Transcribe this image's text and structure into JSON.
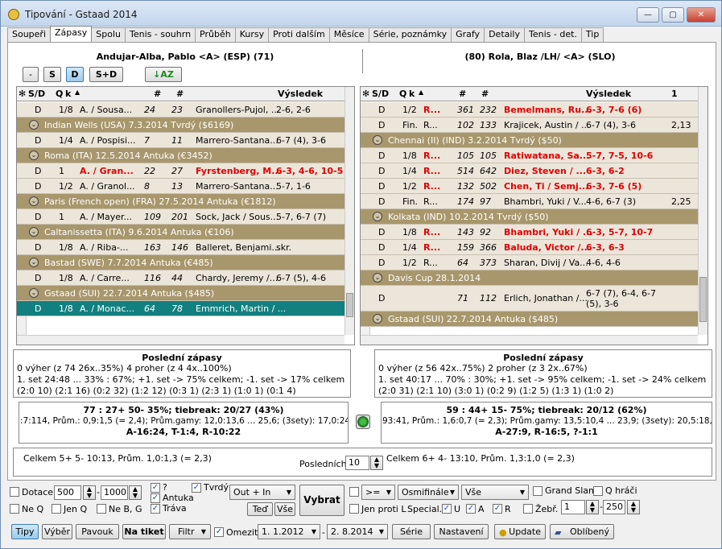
{
  "window": {
    "title": "Tipování - Gstaad 2014",
    "min": "—",
    "max": "▢",
    "close": "✕"
  },
  "tabs": [
    "Soupeři",
    "Zápasy",
    "Spolu",
    "Tenis - souhrn",
    "Průběh",
    "Kursy",
    "Proti dalším",
    "Měsíce",
    "Série, poznámky",
    "Grafy",
    "Detaily",
    "Tenis - det.",
    "Tip"
  ],
  "active_tab": "Zápasy",
  "left": {
    "player": "Andujar-Alba, Pablo <A> (ESP) (71)",
    "buttons": [
      "-",
      "S",
      "D",
      "S+D"
    ],
    "cols": [
      "S/D",
      "Q",
      "k",
      "#",
      "#",
      "Výsledek"
    ],
    "rows": [
      {
        "t": "m",
        "c": [
          "D",
          "1/8",
          "A. / Sousa...",
          "24",
          "23",
          "Granollers-Pujol, ...",
          "2-6, 2-6"
        ]
      },
      {
        "t": "g",
        "c": [
          "Indian Wells (USA) 7.3.2014  Tvrdý  ($6169)"
        ]
      },
      {
        "t": "m",
        "c": [
          "D",
          "1/4",
          "A. / Pospisi...",
          "7",
          "11",
          "Marrero-Santana...",
          "6-7 (4), 3-6"
        ]
      },
      {
        "t": "g",
        "c": [
          "Roma (ITA) 12.5.2014  Antuka  (€3452)"
        ]
      },
      {
        "t": "r",
        "c": [
          "D",
          "1",
          "A. / Gran...",
          "22",
          "27",
          "Fyrstenberg, M...",
          "6-3, 4-6, 10-5"
        ]
      },
      {
        "t": "m",
        "c": [
          "D",
          "1/2",
          "A. / Granol...",
          "8",
          "13",
          "Marrero-Santana...",
          "5-7, 1-6"
        ]
      },
      {
        "t": "g",
        "c": [
          "Paris (French open) (FRA) 27.5.2014  Antuka  (€1812)"
        ]
      },
      {
        "t": "m",
        "c": [
          "D",
          "1",
          "A. / Mayer...",
          "109",
          "201",
          "Sock, Jack / Sous...",
          "5-7, 6-7 (7)"
        ]
      },
      {
        "t": "g",
        "c": [
          "Caltanissetta (ITA) 9.6.2014  Antuka  (€106)"
        ]
      },
      {
        "t": "m",
        "c": [
          "D",
          "1/8",
          "A. / Riba-...",
          "163",
          "146",
          "Balleret, Benjami...",
          "skr."
        ]
      },
      {
        "t": "g",
        "c": [
          "Bastad (SWE) 7.7.2014  Antuka  (€485)"
        ]
      },
      {
        "t": "m",
        "c": [
          "D",
          "1/8",
          "A. / Carre...",
          "116",
          "44",
          "Chardy, Jeremy /...",
          "6-7 (5), 4-6"
        ]
      },
      {
        "t": "g",
        "c": [
          "Gstaad (SUI) 22.7.2014  Antuka  ($485)"
        ]
      },
      {
        "t": "s",
        "c": [
          "D",
          "1/8",
          "A. / Monac...",
          "64",
          "78",
          "Emmrich, Martin / ...",
          ""
        ]
      }
    ],
    "summary_title": "Poslední zápasy",
    "summary": [
      "0 výher (z 74 26x..35%)          4 proher (z 4 4x..100%)",
      "1. set   24:48 ... 33% : 67%; +1. set -> 75% celkem; -1. set -> 17% celkem",
      "(2:0 10) (2:1 16) (0:2 32) (1:2 12) (0:3 1) (2:3 1) (1:0 1) (0:1 4)"
    ],
    "stats": [
      "77 : 27+  50-  35%; tiebreak: 20/27 (43%)",
      ":7:114, Prům.: 0,9:1,5 (= 2,4);  Prům.gamy: 12,0:13,6 ... 25,6;  (3sety): 17,0:24,5",
      "A-16:24, T-1:4, R-10:22"
    ],
    "totals": "Celkem  5+  5-   10:13,  Prům. 1,0:1,3 (= 2,3)"
  },
  "right": {
    "player": "(80) Rola, Blaz /LH/ <A> (SLO)",
    "cols": [
      "S/D",
      "Q",
      "k",
      "#",
      "#",
      "Výsledek",
      "1"
    ],
    "rows": [
      {
        "t": "r",
        "c": [
          "D",
          "1/2",
          "R...",
          "361",
          "232",
          "Bemelmans, Ru...",
          "6-3, 7-6 (6)",
          ""
        ]
      },
      {
        "t": "m",
        "c": [
          "D",
          "Fin.",
          "R...",
          "102",
          "133",
          "Krajicek, Austin / ...",
          "6-7 (4), 3-6",
          "2,13"
        ]
      },
      {
        "t": "g",
        "c": [
          "Chennai (II) (IND) 3.2.2014  Tvrdý  ($50)"
        ]
      },
      {
        "t": "r",
        "c": [
          "D",
          "1/8",
          "R...",
          "105",
          "105",
          "Ratiwatana, Sa...",
          "5-7, 7-5, 10-6",
          ""
        ]
      },
      {
        "t": "r",
        "c": [
          "D",
          "1/4",
          "R...",
          "514",
          "642",
          "Diez, Steven / ...",
          "6-3, 6-2",
          ""
        ]
      },
      {
        "t": "r",
        "c": [
          "D",
          "1/2",
          "R...",
          "132",
          "502",
          "Chen, Ti / Semj...",
          "6-3, 7-6 (5)",
          ""
        ]
      },
      {
        "t": "m",
        "c": [
          "D",
          "Fin.",
          "R...",
          "174",
          "97",
          "Bhambri, Yuki / V...",
          "4-6, 6-7 (3)",
          "2,25"
        ]
      },
      {
        "t": "g",
        "c": [
          "Kolkata (IND) 10.2.2014  Tvrdý  ($50)"
        ]
      },
      {
        "t": "r",
        "c": [
          "D",
          "1/8",
          "R...",
          "143",
          "92",
          "Bhambri, Yuki / ...",
          "6-3, 5-7, 10-7",
          ""
        ]
      },
      {
        "t": "r",
        "c": [
          "D",
          "1/4",
          "R...",
          "159",
          "366",
          "Baluda, Victor /...",
          "6-3, 6-3",
          ""
        ]
      },
      {
        "t": "m",
        "c": [
          "D",
          "1/2",
          "R...",
          "64",
          "373",
          "Sharan, Divij / Va...",
          "4-6, 4-6",
          ""
        ]
      },
      {
        "t": "g",
        "c": [
          "Davis Cup 28.1.2014"
        ]
      },
      {
        "t": "tall",
        "c": [
          "D",
          "",
          "",
          "71",
          "112",
          "Erlich, Jonathan /...",
          "6-7 (7), 6-4, 6-7",
          "(5), 3-6"
        ]
      },
      {
        "t": "g",
        "c": [
          "Gstaad (SUI) 22.7.2014  Antuka  ($485)"
        ]
      }
    ],
    "summary_title": "Poslední zápasy",
    "summary": [
      "0 výher (z 56 42x..75%)          2 proher (z 3 2x..67%)",
      "1. set   40:17 ... 70% : 30%; +1. set -> 95% celkem; -1. set -> 24% celkem",
      "(2:0 31) (2:1 10) (3:0 1) (0:2 9) (1:2 5) (1:3 1) (1:0 2)"
    ],
    "stats": [
      "59 : 44+  15-  75%; tiebreak: 20/12 (62%)",
      "93:41, Prům.: 1,6:0,7 (= 2,3);  Prům.gamy: 13,5:10,4 ... 23,9;  (3sety): 20,5:18,0 ...",
      "A-27:9, R-16:5, ?-1:1"
    ],
    "totals": "Celkem  6+  4-   13:10,  Prům. 1,3:1,0 (= 2,3)"
  },
  "posledni": {
    "label": "Posledních",
    "value": "10"
  },
  "filters": {
    "dotace": "Dotace",
    "dotace_min": "500",
    "dotace_max": "1000",
    "ne_q": "Ne Q",
    "jen_q": "Jen Q",
    "ne_bg": "Ne B, G",
    "q_mark": "?",
    "antuka": "Antuka",
    "trava": "Tráva",
    "tvrdy": "Tvrdý",
    "out_in": "Out + In",
    "ted": "Teď",
    "vse_btn": "Vše",
    "vybrat": "Vybrat",
    "cmp": ">=",
    "round": "Osmifinále",
    "scope": "Vše",
    "jen_proti": "Jen proti L",
    "special": "Special.",
    "u": "U",
    "a": "A",
    "r": "R",
    "grand_slam": "Grand Slam",
    "q_hraci": "Q hráči",
    "zebr": "Žebř.",
    "zebr_min": "1",
    "zebr_max": "250"
  },
  "bottom": {
    "tipy": "Tipy",
    "vyber": "Výběr",
    "pavouk": "Pavouk",
    "na_tiket": "Na tiket",
    "filtr": "Filtr",
    "omezit": "Omezit",
    "date_from": "1. 1.2012",
    "date_to": "2. 8.2014",
    "serie": "Série",
    "nastaveni": "Nastavení",
    "update": "Update",
    "oblibeny": "Oblíbený"
  }
}
